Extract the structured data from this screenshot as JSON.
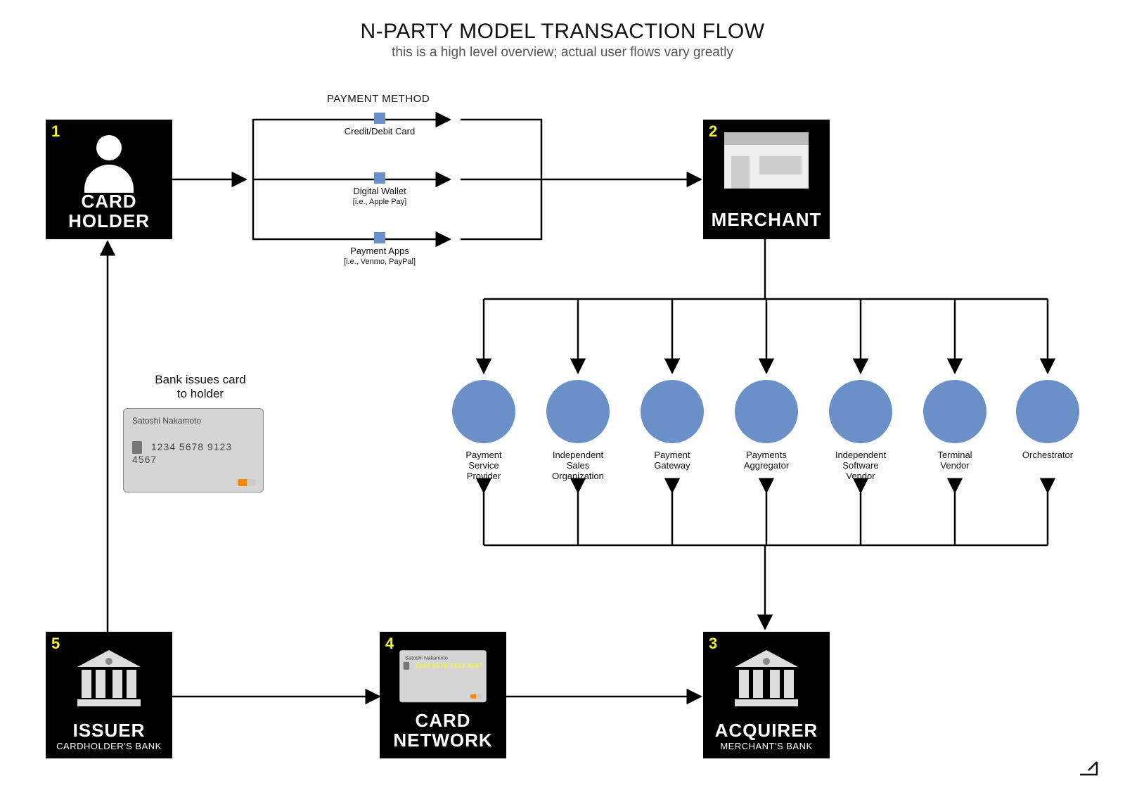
{
  "title": "N-PARTY MODEL TRANSACTION FLOW",
  "subtitle": "this is a high level overview; actual user flows vary greatly",
  "nodes": {
    "cardholder": {
      "num": "1",
      "label_l1": "CARD",
      "label_l2": "HOLDER"
    },
    "merchant": {
      "num": "2",
      "label": "MERCHANT"
    },
    "acquirer": {
      "num": "3",
      "label": "ACQUIRER",
      "sub": "MERCHANT'S BANK"
    },
    "cardnetwork": {
      "num": "4",
      "label_l1": "CARD",
      "label_l2": "NETWORK"
    },
    "issuer": {
      "num": "5",
      "label": "ISSUER",
      "sub": "CARDHOLDER'S BANK"
    }
  },
  "payment_method": {
    "title": "PAYMENT METHOD",
    "items": [
      {
        "name": "Credit/Debit Card"
      },
      {
        "name": "Digital Wallet",
        "note": "[i.e., Apple Pay]"
      },
      {
        "name": "Payment Apps",
        "note": "[i.e., Venmo, PayPal]"
      }
    ]
  },
  "providers": [
    "Payment Service Provider",
    "Independent Sales Organization",
    "Payment Gateway",
    "Payments Aggregator",
    "Independent Software Vendor",
    "Terminal Vendor",
    "Orchestrator"
  ],
  "issue_card": {
    "caption_l1": "Bank issues card",
    "caption_l2": "to holder",
    "name": "Satoshi Nakamoto",
    "number": "1234 5678 9123 4567"
  },
  "colors": {
    "accent": "#6b8fc7",
    "num": "#f5f52e"
  }
}
